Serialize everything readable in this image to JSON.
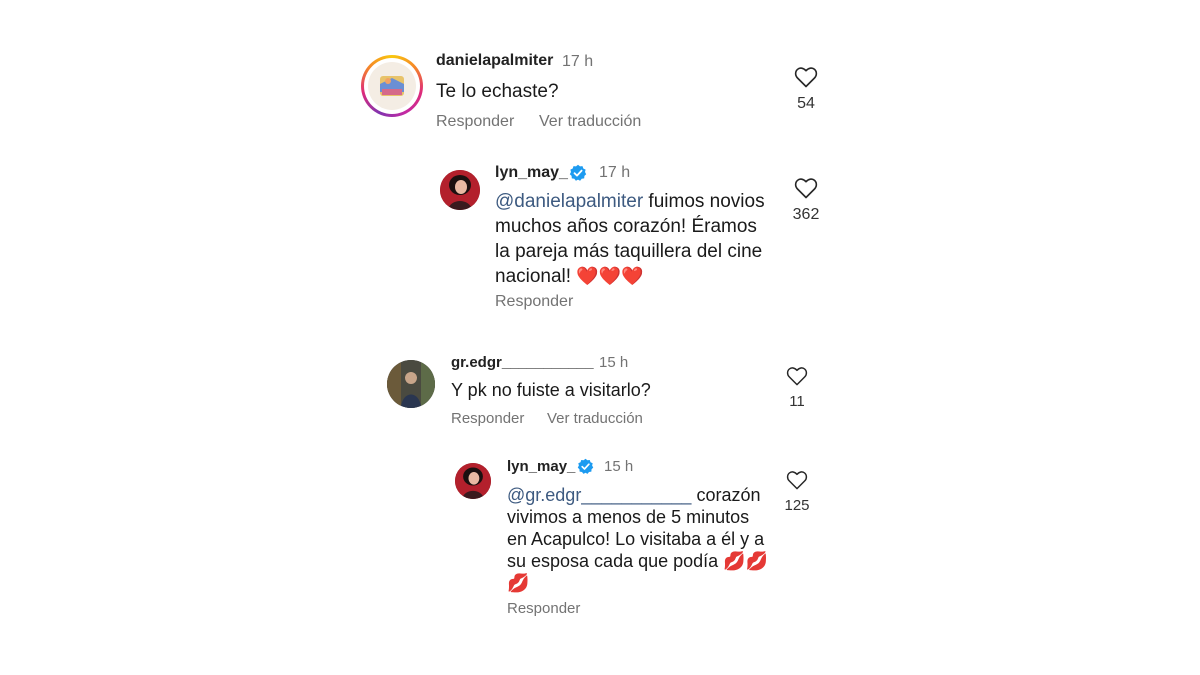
{
  "comments": [
    {
      "username": "danielapalmiter",
      "time": "17 h",
      "text": "Te lo echaste?",
      "actions": {
        "reply": "Responder",
        "translate": "Ver traducción"
      },
      "likes": "54",
      "replies": [
        {
          "username": "lyn_may_",
          "verified": true,
          "time": "17 h",
          "mention": "@danielapalmiter",
          "text_line1": " fuimos novios",
          "text_line2": "muchos años corazón! Éramos",
          "text_line3": "la pareja más taquillera del cine",
          "text_line4": "nacional! ",
          "emoji": "❤️❤️❤️",
          "actions": {
            "reply": "Responder"
          },
          "likes": "362"
        }
      ]
    },
    {
      "username": "gr.edgr___________",
      "time": "15 h",
      "text": "Y pk no fuiste a visitarlo?",
      "actions": {
        "reply": "Responder",
        "translate": "Ver traducción"
      },
      "likes": "11",
      "replies": [
        {
          "username": "lyn_may_",
          "verified": true,
          "time": "15 h",
          "mention": "@gr.edgr___________",
          "text_line1": " corazón",
          "text_line2": "vivimos a menos de 5 minutos",
          "text_line3": "en Acapulco! Lo visitaba a él y a",
          "text_line4": "su esposa cada que podía ",
          "emoji": "💋💋",
          "emoji2": "💋",
          "actions": {
            "reply": "Responder"
          },
          "likes": "125"
        }
      ]
    }
  ],
  "colors": {
    "verified": "#1d9bf0",
    "mention": "#3d5a80",
    "muted": "#737373"
  },
  "icons": {
    "like": "heart-outline-icon",
    "verified": "verified-badge-icon"
  }
}
